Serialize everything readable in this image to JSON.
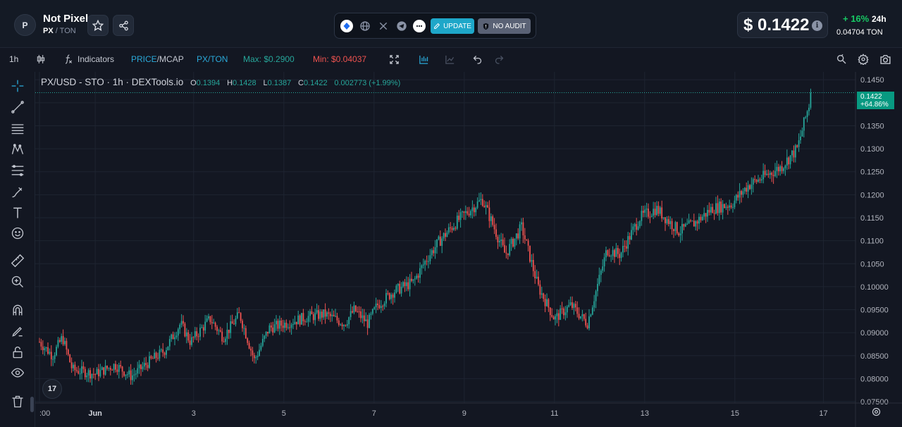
{
  "header": {
    "avatar_letter": "P",
    "token_name": "Not Pixel",
    "symbol": "PX",
    "separator": "/",
    "quote": "TON",
    "update_label": "UPDATE",
    "no_audit_label": "NO AUDIT",
    "price": "$ 0.1422",
    "change": "+ 16%",
    "change_period": "24h",
    "ton_price": "0.04704 TON"
  },
  "toolbar": {
    "interval": "1h",
    "indicators_label": "Indicators",
    "price_label": "PRICE",
    "mcap_label": "/MCAP",
    "pair_label": "PX/TON",
    "max_label": "Max: $0.2900",
    "min_label": "Min: $0.04037"
  },
  "legend": {
    "title": "PX/USD - STO · 1h · DEXTools.io",
    "o_label": "O",
    "o_value": "0.1394",
    "h_label": "H",
    "h_value": "0.1428",
    "l_label": "L",
    "l_value": "0.1387",
    "c_label": "C",
    "c_value": "0.1422",
    "change": "0.002773 (+1.99%)"
  },
  "price_tag": {
    "price": "0.1422",
    "pct": "+64.86%"
  },
  "tv_logo": "17",
  "colors": {
    "up": "#26a69a",
    "down": "#ef5350",
    "accent": "#1ea7c9",
    "positive": "#17c964"
  },
  "chart_data": {
    "type": "candlestick",
    "title": "PX/USD - STO · 1h · DEXTools.io",
    "y_ticks": [
      "0.1450",
      "0.1400",
      "0.1350",
      "0.1300",
      "0.1250",
      "0.1200",
      "0.1150",
      "0.1100",
      "0.1050",
      "0.10000",
      "0.09500",
      "0.09000",
      "0.08500",
      "0.08000",
      "0.07500"
    ],
    "x_ticks": [
      ":00",
      "Jun",
      "3",
      "5",
      "7",
      "9",
      "11",
      "13",
      "15",
      "17"
    ],
    "ylim": [
      0.0747,
      0.1458
    ],
    "last_price": 0.1422,
    "grid": true,
    "path": [
      [
        0,
        0.088
      ],
      [
        0.04,
        0.085
      ],
      [
        0.07,
        0.089
      ],
      [
        0.1,
        0.082
      ],
      [
        0.17,
        0.081
      ],
      [
        0.23,
        0.083
      ],
      [
        0.28,
        0.0805
      ],
      [
        0.34,
        0.084
      ],
      [
        0.38,
        0.086
      ],
      [
        0.43,
        0.092
      ],
      [
        0.46,
        0.088
      ],
      [
        0.52,
        0.093
      ],
      [
        0.56,
        0.089
      ],
      [
        0.61,
        0.094
      ],
      [
        0.655,
        0.084
      ],
      [
        0.7,
        0.091
      ],
      [
        0.75,
        0.092
      ],
      [
        0.82,
        0.0935
      ],
      [
        0.87,
        0.094
      ],
      [
        0.93,
        0.092
      ],
      [
        0.96,
        0.095
      ],
      [
        1.0,
        0.092
      ],
      [
        1.03,
        0.096
      ],
      [
        1.08,
        0.099
      ],
      [
        1.14,
        0.101
      ],
      [
        1.18,
        0.106
      ],
      [
        1.22,
        0.11
      ],
      [
        1.27,
        0.114
      ],
      [
        1.3,
        0.116
      ],
      [
        1.35,
        0.119
      ],
      [
        1.42,
        0.107
      ],
      [
        1.47,
        0.113
      ],
      [
        1.52,
        0.1
      ],
      [
        1.57,
        0.093
      ],
      [
        1.62,
        0.096
      ],
      [
        1.67,
        0.092
      ],
      [
        1.73,
        0.108
      ],
      [
        1.77,
        0.107
      ],
      [
        1.83,
        0.115
      ],
      [
        1.88,
        0.117
      ],
      [
        1.95,
        0.112
      ],
      [
        2.0,
        0.114
      ],
      [
        2.05,
        0.117
      ],
      [
        2.11,
        0.118
      ],
      [
        2.16,
        0.122
      ],
      [
        2.21,
        0.124
      ],
      [
        2.26,
        0.126
      ],
      [
        2.31,
        0.13
      ],
      [
        2.355,
        0.142
      ]
    ]
  }
}
